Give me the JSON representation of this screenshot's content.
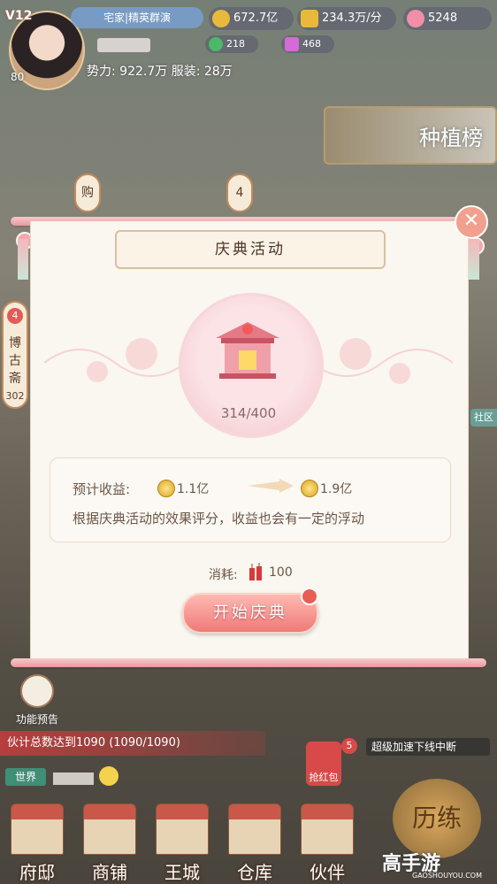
{
  "hud": {
    "vip": "V12",
    "level": "80",
    "title_bar": "宅家|精英群演",
    "power": "势力: 922.7万  服装: 28万",
    "currency": [
      {
        "name": "silver",
        "value": "672.7亿",
        "color": "#e8b93a"
      },
      {
        "name": "income",
        "value": "234.3万/分",
        "color": "#e8b93a"
      },
      {
        "name": "gem",
        "value": "5248",
        "color": "#f08fa6"
      },
      {
        "name": "jade",
        "value": "218",
        "color": "#4cb86a"
      },
      {
        "name": "ticket",
        "value": "468",
        "color": "#d56ad8"
      }
    ]
  },
  "left_tabs": {
    "shop": "购",
    "shop_count": "4",
    "bogu_label": "博古斋",
    "bogu_count": "302",
    "bogu_badge": "4"
  },
  "right_widgets": {
    "plant_board": "种植榜",
    "community": "社区"
  },
  "modal": {
    "title": "庆典活动",
    "progress": "314/400",
    "expected_label": "预计收益:",
    "expected_from": "1.1亿",
    "expected_to": "1.9亿",
    "note": "根据庆典活动的效果评分，收益也会有一定的浮动",
    "cost_label": "消耗:",
    "cost_value": "100",
    "start_button": "开始庆典",
    "close_icon": "close-icon"
  },
  "bottom": {
    "preview_label": "功能预告",
    "task_text": "伙计总数达到1090 (1090/1090)",
    "notice_text": "超级加速下线中断",
    "notice_badge": "5",
    "redpacket_label": "抢红包",
    "world_tag": "世界",
    "nav": [
      "府邸",
      "商铺",
      "王城",
      "仓库",
      "伙伴"
    ],
    "history_label": "历练",
    "watermark": "高手游",
    "watermark_sub": "GAOSHOUYOU.COM"
  }
}
